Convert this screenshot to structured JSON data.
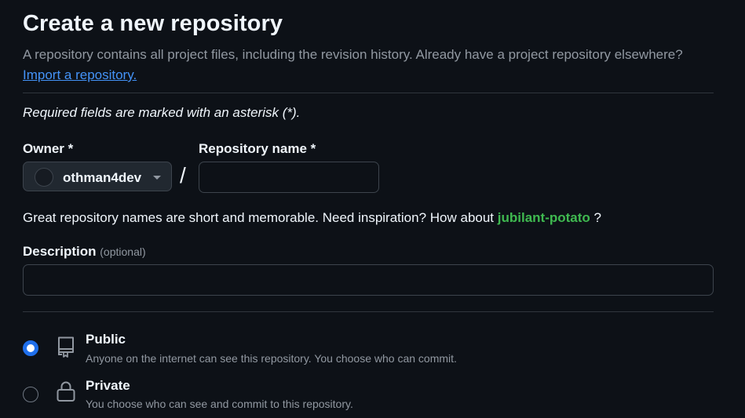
{
  "header": {
    "title": "Create a new repository",
    "subtitle": "A repository contains all project files, including the revision history. Already have a project repository elsewhere?",
    "import_link": "Import a repository."
  },
  "form": {
    "required_note": "Required fields are marked with an asterisk (*).",
    "owner": {
      "label": "Owner *",
      "value": "othman4dev"
    },
    "separator": "/",
    "repo_name": {
      "label": "Repository name *",
      "value": ""
    },
    "name_hint": {
      "prefix": "Great repository names are short and memorable. Need inspiration? How about ",
      "suggestion": "jubilant-potato",
      "suffix": " ?"
    },
    "description": {
      "label": "Description",
      "optional": "(optional)",
      "value": ""
    },
    "visibility": {
      "selected": "public",
      "options": [
        {
          "id": "public",
          "title": "Public",
          "description": "Anyone on the internet can see this repository. You choose who can commit.",
          "icon": "repo-icon"
        },
        {
          "id": "private",
          "title": "Private",
          "description": "You choose who can see and commit to this repository.",
          "icon": "lock-icon"
        }
      ]
    }
  },
  "colors": {
    "background": "#0d1117",
    "link": "#4493f8",
    "suggestion": "#3fb950",
    "radio_selected": "#1f6feb"
  }
}
